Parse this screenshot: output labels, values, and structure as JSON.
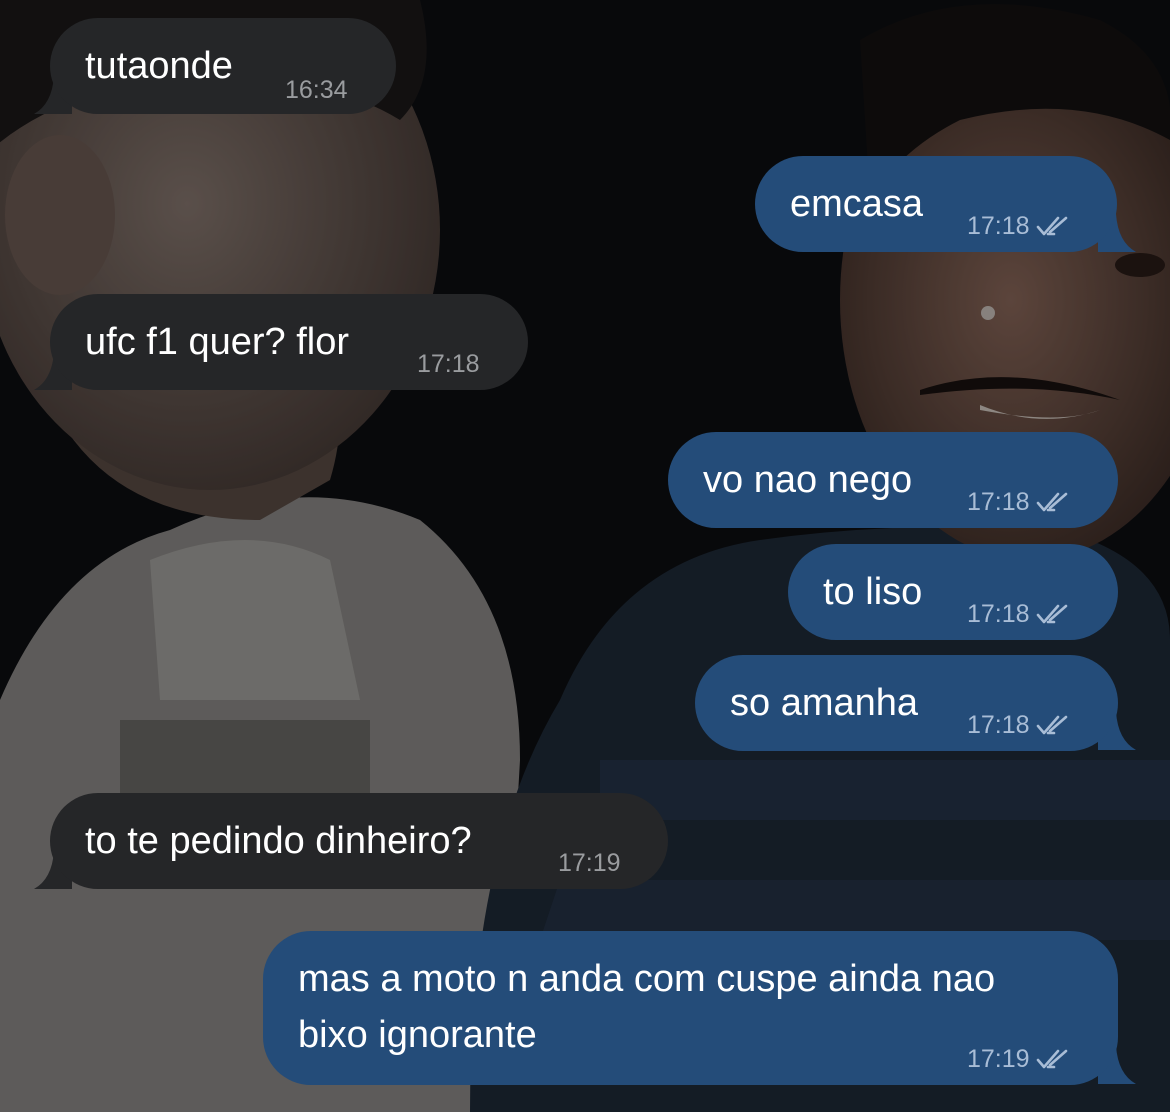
{
  "messages": [
    {
      "direction": "incoming",
      "text": "tutaonde",
      "time": "16:34"
    },
    {
      "direction": "outgoing",
      "text": "emcasa",
      "time": "17:18",
      "status": "read"
    },
    {
      "direction": "incoming",
      "text": "ufc f1 quer? flor",
      "time": "17:18"
    },
    {
      "direction": "outgoing",
      "text": "vo nao nego",
      "time": "17:18",
      "status": "read"
    },
    {
      "direction": "outgoing",
      "text": "to liso",
      "time": "17:18",
      "status": "read"
    },
    {
      "direction": "outgoing",
      "text": "so amanha",
      "time": "17:18",
      "status": "read"
    },
    {
      "direction": "incoming",
      "text": "to te pedindo dinheiro?",
      "time": "17:19"
    },
    {
      "direction": "outgoing",
      "text": "mas a moto n anda com cuspe ainda nao\nbixo ignorante",
      "time": "17:19",
      "status": "read"
    }
  ],
  "theme": {
    "incoming_bubble": "#252628",
    "outgoing_bubble": "#244c79",
    "text": "#ffffff",
    "read_receipt_icon": "double-check-icon"
  }
}
